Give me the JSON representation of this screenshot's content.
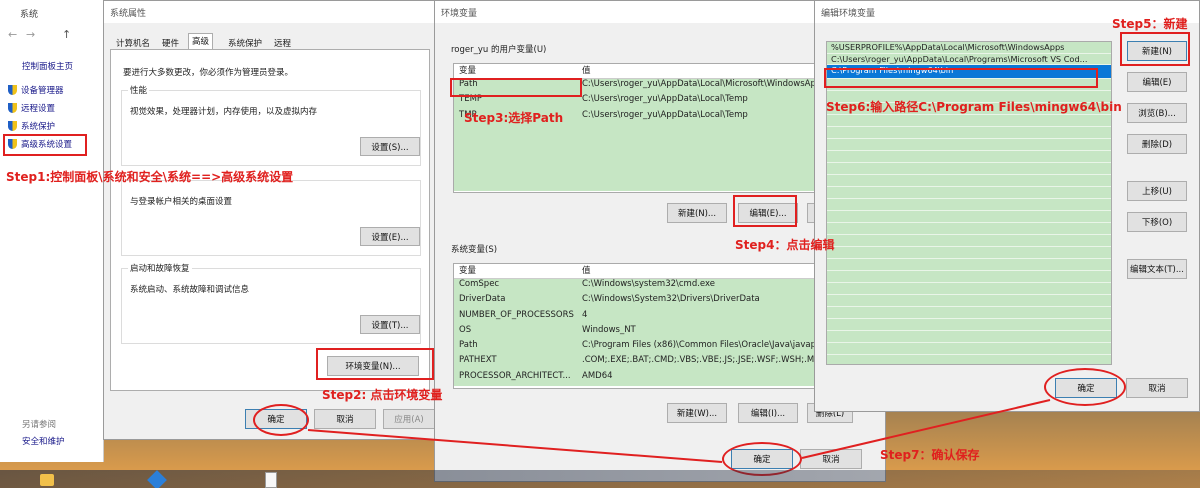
{
  "explorer": {
    "title": "系统",
    "nav": [
      "控制面板主页",
      "设备管理器",
      "远程设置",
      "系统保护",
      "高级系统设置"
    ],
    "see_also_title": "另请参阅",
    "see_also_item": "安全和维护"
  },
  "sysprops": {
    "title": "系统属性",
    "tabs": [
      "计算机名",
      "硬件",
      "高级",
      "系统保护",
      "远程"
    ],
    "admin_note": "要进行大多数更改，你必须作为管理员登录。",
    "perf_title": "性能",
    "perf_desc": "视觉效果，处理器计划，内存使用，以及虚拟内存",
    "profile_desc": "与登录帐户相关的桌面设置",
    "startup_title": "启动和故障恢复",
    "startup_desc": "系统启动、系统故障和调试信息",
    "settings_s": "设置(S)...",
    "settings_e": "设置(E)...",
    "settings_t": "设置(T)...",
    "env_button": "环境变量(N)...",
    "ok": "确定",
    "cancel": "取消",
    "apply": "应用(A)"
  },
  "envvars": {
    "title": "环境变量",
    "user_group": "roger_yu 的用户变量(U)",
    "col_var": "变量",
    "col_val": "值",
    "user_rows": [
      {
        "name": "Path",
        "value": "C:\\Users\\roger_yu\\AppData\\Local\\Microsoft\\WindowsApps"
      },
      {
        "name": "TEMP",
        "value": "C:\\Users\\roger_yu\\AppData\\Local\\Temp"
      },
      {
        "name": "TMP",
        "value": "C:\\Users\\roger_yu\\AppData\\Local\\Temp"
      }
    ],
    "new_u": "新建(N)...",
    "edit_e": "编辑(E)...",
    "sys_group": "系统变量(S)",
    "sys_rows": [
      {
        "name": "ComSpec",
        "value": "C:\\Windows\\system32\\cmd.exe"
      },
      {
        "name": "DriverData",
        "value": "C:\\Windows\\System32\\Drivers\\DriverData"
      },
      {
        "name": "NUMBER_OF_PROCESSORS",
        "value": "4"
      },
      {
        "name": "OS",
        "value": "Windows_NT"
      },
      {
        "name": "Path",
        "value": "C:\\Program Files (x86)\\Common Files\\Oracle\\Java\\javapath"
      },
      {
        "name": "PATHEXT",
        "value": ".COM;.EXE;.BAT;.CMD;.VBS;.VBE;.JS;.JSE;.WSF;.WSH;.MSC"
      },
      {
        "name": "PROCESSOR_ARCHITECT...",
        "value": "AMD64"
      }
    ],
    "new_w": "新建(W)...",
    "edit_i": "编辑(I)...",
    "delete_l": "删除(L)",
    "ok": "确定",
    "cancel": "取消"
  },
  "editenv": {
    "title": "编辑环境变量",
    "items": [
      "%USERPROFILE%\\AppData\\Local\\Microsoft\\WindowsApps",
      "C:\\Users\\roger_yu\\AppData\\Local\\Programs\\Microsoft VS Cod...",
      "C:\\Program Files\\mingw64\\bin"
    ],
    "new": "新建(N)",
    "edit": "编辑(E)",
    "browse": "浏览(B)...",
    "delete": "删除(D)",
    "up": "上移(U)",
    "down": "下移(O)",
    "edit_text": "编辑文本(T)...",
    "ok": "确定",
    "cancel": "取消"
  },
  "annotations": {
    "step1": "Step1:控制面板\\系统和安全\\系统==>高级系统设置",
    "step2": "Step2: 点击环境变量",
    "step3": "Step3:选择Path",
    "step4": "Step4：点击编辑",
    "step5": "Step5：新建",
    "step6": "Step6:输入路径C:\\Program Files\\mingw64\\bin",
    "step7": "Step7：确认保存"
  },
  "colors": {
    "annotation_red": "#e0201e",
    "row_green": "#c6e6c4",
    "selection_blue": "#0a78d7"
  }
}
